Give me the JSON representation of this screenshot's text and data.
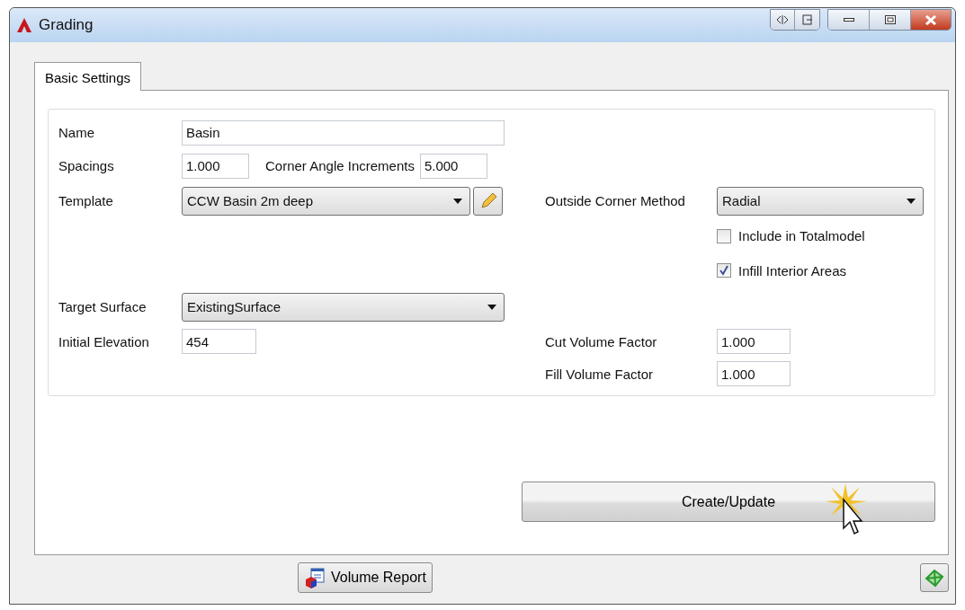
{
  "window": {
    "title": "Grading"
  },
  "tabs": [
    {
      "label": "Basic Settings",
      "selected": true
    }
  ],
  "form": {
    "name": {
      "label": "Name",
      "value": "Basin"
    },
    "spacings": {
      "label": "Spacings",
      "value": "1.000"
    },
    "corner_angle_increments": {
      "label": "Corner Angle Increments",
      "value": "5.000"
    },
    "template": {
      "label": "Template",
      "value": "CCW Basin 2m deep"
    },
    "outside_corner_method": {
      "label": "Outside Corner Method",
      "value": "Radial"
    },
    "checkboxes": [
      {
        "label": "Include in Totalmodel",
        "checked": false
      },
      {
        "label": "Infill Interior Areas",
        "checked": true
      }
    ],
    "target_surface": {
      "label": "Target Surface",
      "value": "ExistingSurface"
    },
    "initial_elevation": {
      "label": "Initial Elevation",
      "value": "454"
    },
    "cut_volume_factor": {
      "label": "Cut Volume Factor",
      "value": "1.000"
    },
    "fill_volume_factor": {
      "label": "Fill Volume Factor",
      "value": "1.000"
    }
  },
  "create_button": {
    "label": "Create/Update"
  },
  "volume_report_button": {
    "label": "Volume Report"
  }
}
